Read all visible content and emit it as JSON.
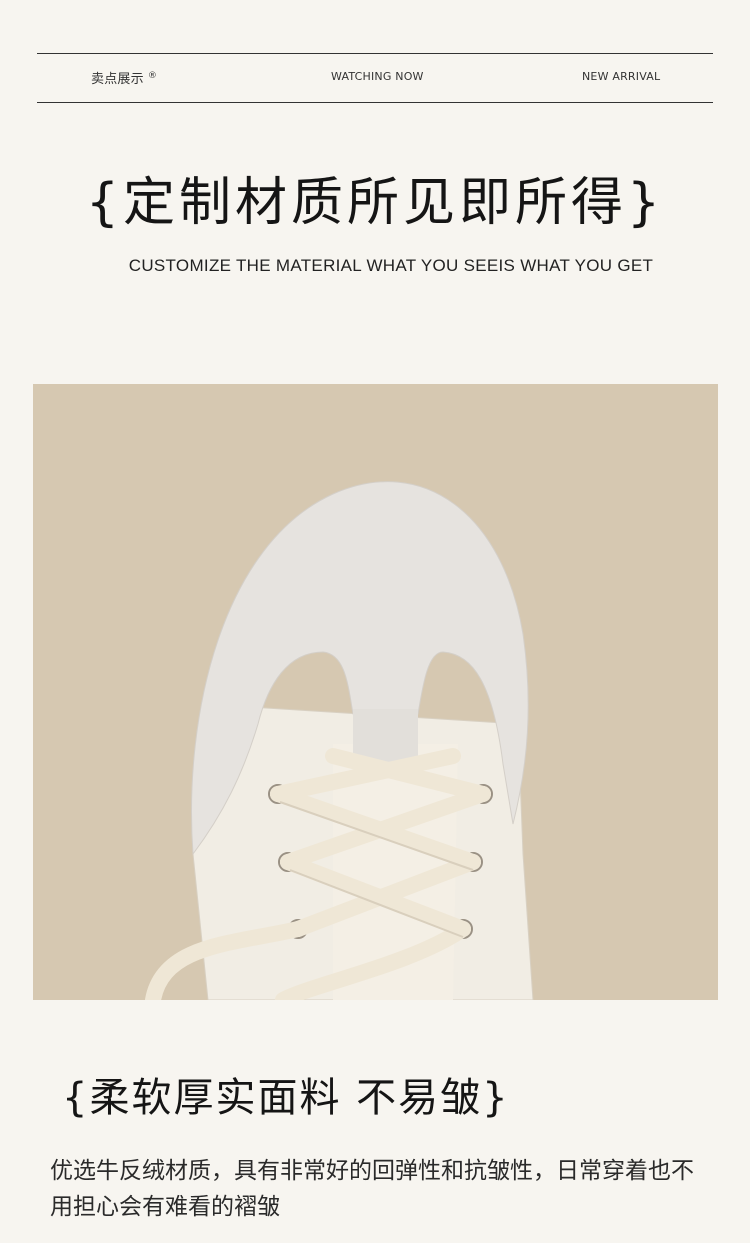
{
  "nav": {
    "item1": "卖点展示",
    "item1_mark": "®",
    "item2": "WATCHING NOW",
    "item3": "NEW ARRIVAL"
  },
  "headline": {
    "title": "{定制材质所见即所得}",
    "subtitle": "CUSTOMIZE THE MATERIAL WHAT YOU SEEIS WHAT YOU GET"
  },
  "section2": {
    "title": "{柔软厚实面料  不易皱}",
    "description": "优选牛反绒材质，具有非常好的回弹性和抗皱性，日常穿着也不用担心会有难看的褶皱"
  },
  "colors": {
    "background": "#f7f5f0",
    "photo_background": "#d6c8b1",
    "suede": "#e6e3df",
    "leather": "#f1ede4",
    "lace": "#efe7d6"
  }
}
